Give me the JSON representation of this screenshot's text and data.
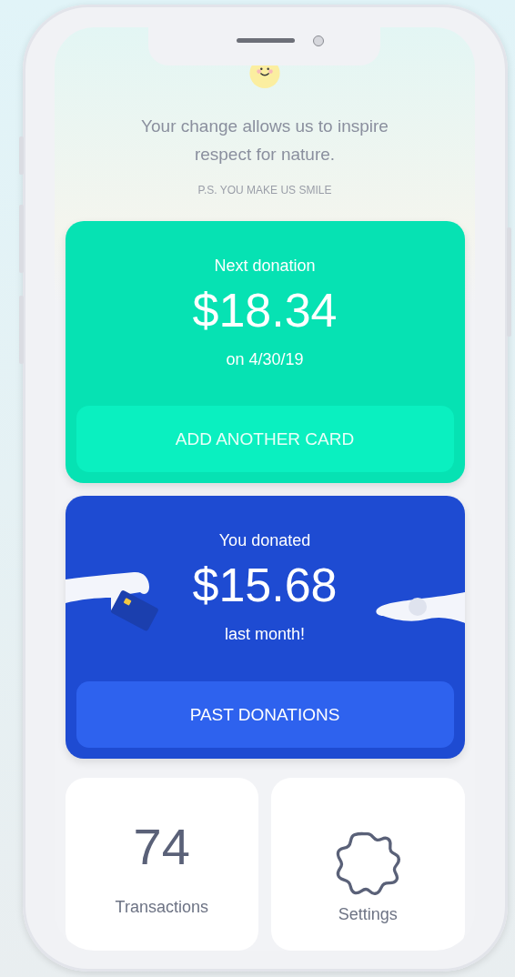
{
  "message": "Your change allows us to inspire respect for nature.",
  "ps": "P.S. YOU MAKE US SMILE",
  "cards": [
    {
      "kind": "next",
      "label": "Next donation",
      "amount": "$18.34",
      "note": "on 4/30/19",
      "button": "ADD ANOTHER CARD"
    },
    {
      "kind": "donated",
      "label": "You donated",
      "amount": "$15.68",
      "note": "last month!",
      "button": "PAST DONATIONS"
    }
  ],
  "tiles": [
    {
      "kind": "count",
      "value": "74",
      "label": "Transactions"
    },
    {
      "kind": "settings",
      "label": "Settings"
    }
  ]
}
